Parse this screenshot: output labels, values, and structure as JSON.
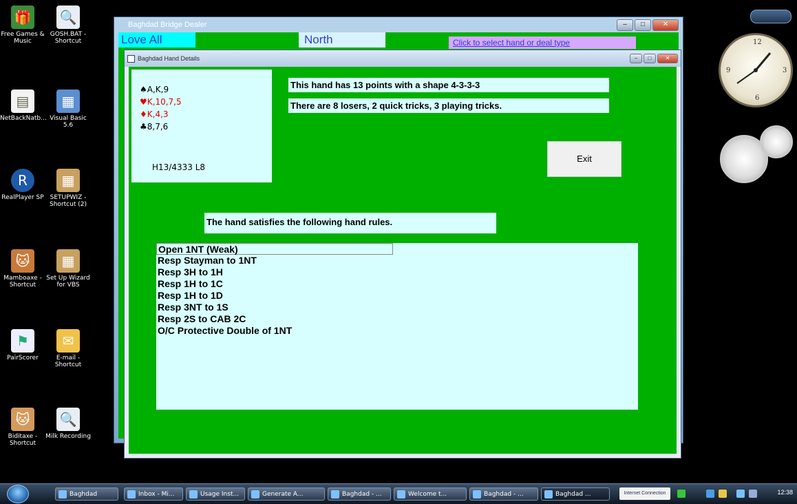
{
  "colors": {
    "client_green": "#00b000",
    "panel_cyan": "#d8ffff",
    "heart_red": "#e00000",
    "link_blue": "#2c3fd2"
  },
  "desktop_icons": [
    {
      "label": "Free Games & Music",
      "icon": "gift-icon"
    },
    {
      "label": "GOSH.BAT - Shortcut",
      "icon": "magnifier-document-icon"
    },
    {
      "label": "NetBackNatb...",
      "icon": "document-icon"
    },
    {
      "label": "Visual Basic 5.6",
      "icon": "setup-box-icon"
    },
    {
      "label": "RealPlayer SP",
      "icon": "realplayer-icon"
    },
    {
      "label": "SETUPWIZ - Shortcut (2)",
      "icon": "setup-box-icon"
    },
    {
      "label": "Mamboaxe - Shortcut",
      "icon": "cat-icon"
    },
    {
      "label": "Set Up Wizard for VBS",
      "icon": "setup-box-icon"
    },
    {
      "label": "PairScorer",
      "icon": "flag-icon"
    },
    {
      "label": "E-mail - Shortcut",
      "icon": "email-icon"
    },
    {
      "label": "Biditaxe - Shortcut",
      "icon": "cat-icon"
    },
    {
      "label": "Milk Recording",
      "icon": "magnifier-document-icon"
    }
  ],
  "main_window": {
    "title": "Baghdad Bridge Dealer",
    "vulnerability": "Love All",
    "seat": "North",
    "select_prompt": "Click to select hand or deal type",
    "controls": {
      "minimize": "–",
      "maximize": "□",
      "close": "✕"
    }
  },
  "dialog": {
    "title": "Baghdad Hand Details",
    "hand": {
      "spades": "♠A,K,9",
      "hearts": "♥K,10,7,5",
      "diamonds": "♦K,4,3",
      "clubs": "♣8,7,6",
      "code": "H13/4333 L8"
    },
    "points_line": "This hand has 13 points with a shape 4-3-3-3",
    "losers_line": "There are 8 losers, 2 quick tricks, 3 playing tricks.",
    "exit_label": "Exit",
    "rules_heading": "The hand satisfies the following hand rules.",
    "rules": [
      "Open 1NT (Weak)",
      "Resp Stayman to 1NT",
      "Resp 3H to 1H",
      "Resp 1H to 1C",
      "Resp 1H to 1D",
      "Resp 3NT to 1S",
      "Resp 2S to CAB 2C",
      "O/C Protective Double of 1NT"
    ]
  },
  "taskbar": {
    "tasks": [
      "Baghdad",
      "Inbox - Mi...",
      "Usage Inst...",
      "Generate A...",
      "Baghdad - ...",
      "Welcome t...",
      "Baghdad - ...",
      "Baghdad ..."
    ],
    "tray_box": "Internet Connection",
    "time": "12:38"
  }
}
